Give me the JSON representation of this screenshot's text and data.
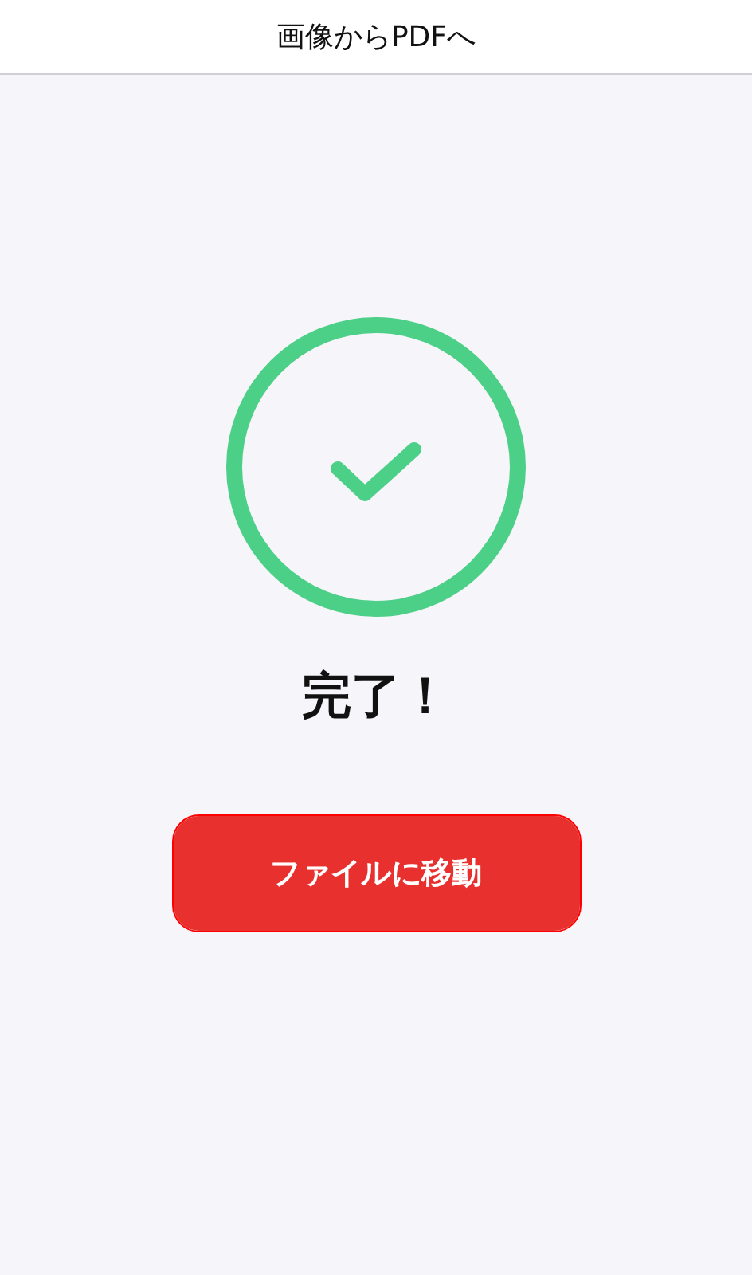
{
  "header": {
    "title": "画像からPDFへ"
  },
  "status": {
    "kind": "success",
    "message": "完了！"
  },
  "button": {
    "label": "ファイルに移動",
    "highlighted": true
  }
}
